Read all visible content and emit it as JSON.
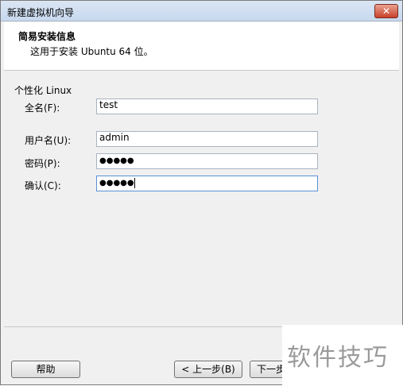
{
  "window": {
    "title": "新建虚拟机向导",
    "close_glyph": "✕"
  },
  "header": {
    "title": "简易安装信息",
    "subtitle": "这用于安装 Ubuntu 64 位。"
  },
  "form": {
    "group_label": "个性化 Linux",
    "fullname_label": "全名(F):",
    "fullname_value": "test",
    "username_label": "用户名(U):",
    "username_value": "admin",
    "password_label": "密码(P):",
    "password_value": "●●●●●",
    "confirm_label": "确认(C):",
    "confirm_value": "●●●●●"
  },
  "buttons": {
    "help": "帮助",
    "back": "< 上一步(B)",
    "next": "下一步"
  },
  "watermark": {
    "text": "软件技巧"
  }
}
